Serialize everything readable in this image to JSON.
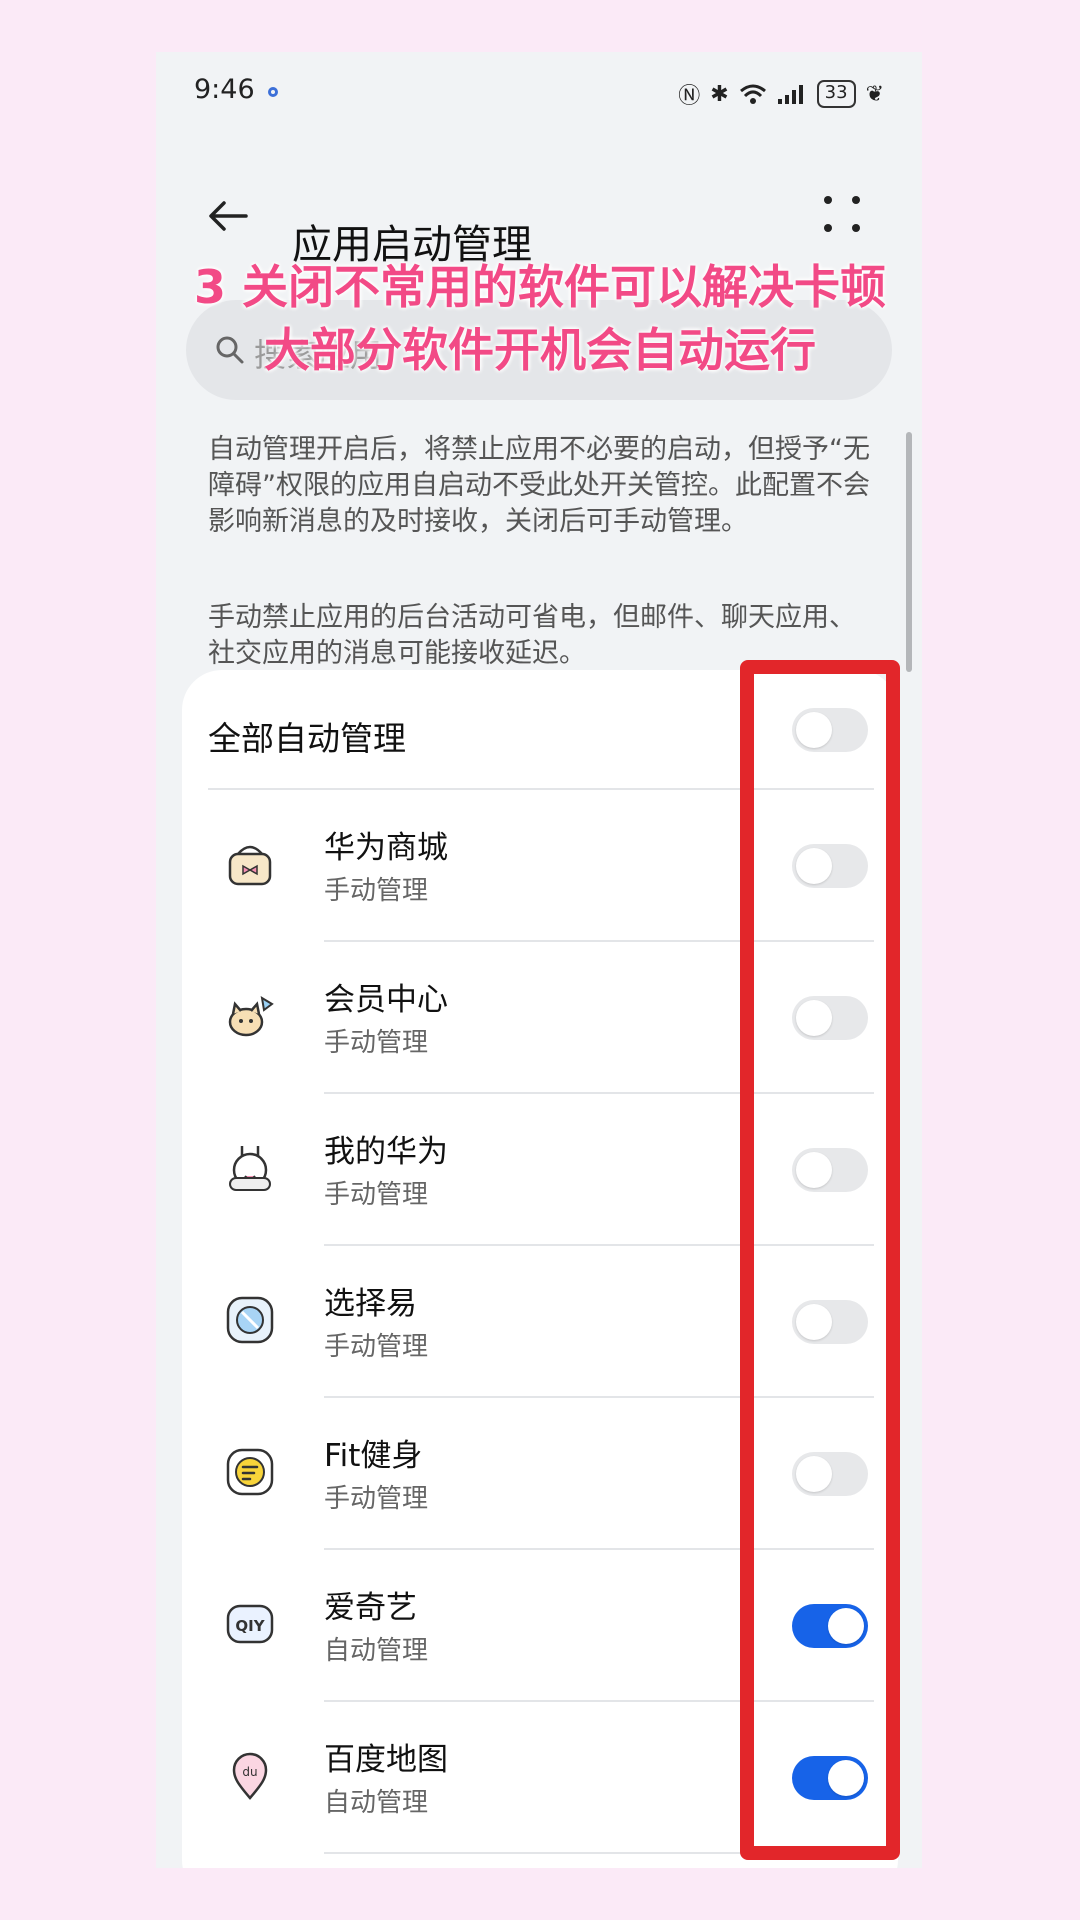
{
  "status_bar": {
    "time": "9:46",
    "battery": "33",
    "signal_icons": [
      "nfc-icon",
      "bluetooth-icon",
      "wifi-icon",
      "cell-signal-icon",
      "battery-icon",
      "leaf-icon"
    ]
  },
  "header": {
    "title": "应用启动管理"
  },
  "search": {
    "placeholder": "搜索应用"
  },
  "overlay": {
    "line1": "3 关闭不常用的软件可以解决卡顿",
    "line2": "大部分软件开机会自动运行"
  },
  "description": {
    "para1": "自动管理开启后，将禁止应用不必要的启动，但授予“无障碍”权限的应用自启动不受此处开关管控。此配置不会影响新消息的及时接收，关闭后可手动管理。",
    "para2": "手动禁止应用的后台活动可省电，但邮件、聊天应用、社交应用的消息可能接收延迟。"
  },
  "all_auto": {
    "label": "全部自动管理",
    "enabled": false
  },
  "apps": [
    {
      "name": "华为商城",
      "mode": "手动管理",
      "enabled": false,
      "icon": "shopping-basket-icon"
    },
    {
      "name": "会员中心",
      "mode": "手动管理",
      "enabled": false,
      "icon": "cat-icon"
    },
    {
      "name": "我的华为",
      "mode": "手动管理",
      "enabled": false,
      "icon": "bunny-icon"
    },
    {
      "name": "选择易",
      "mode": "手动管理",
      "enabled": false,
      "icon": "app-square-icon"
    },
    {
      "name": "Fit健身",
      "mode": "手动管理",
      "enabled": false,
      "icon": "fitness-icon"
    },
    {
      "name": "爱奇艺",
      "mode": "自动管理",
      "enabled": true,
      "icon": "iqiyi-icon"
    },
    {
      "name": "百度地图",
      "mode": "自动管理",
      "enabled": true,
      "icon": "map-pin-icon"
    }
  ],
  "colors": {
    "accent": "#1763e8",
    "highlight": "#e2262a",
    "overlay_text": "#f24a86",
    "background": "#fbeaf7"
  }
}
